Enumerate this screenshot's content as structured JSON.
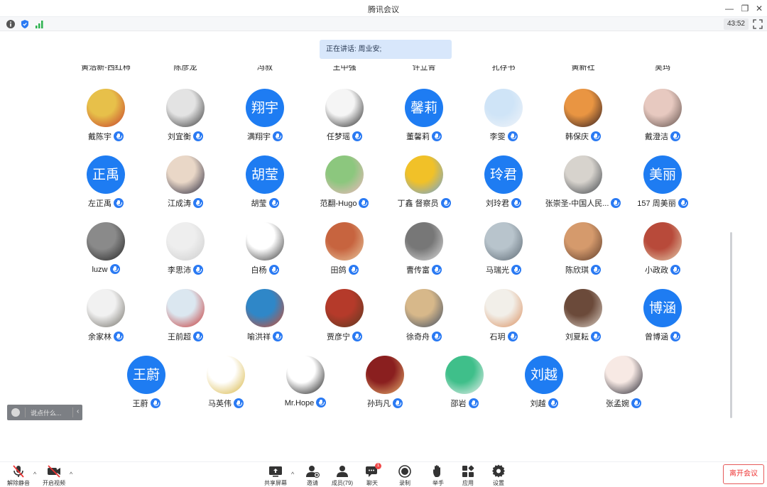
{
  "window": {
    "title": "腾讯会议",
    "min": "—",
    "restore": "❐",
    "close": "✕"
  },
  "infobar": {
    "timer": "43:52"
  },
  "speaking": {
    "text": "正在讲话: 周业安;"
  },
  "cut_row": [
    "黄浩新-西红柿",
    "陈彦龙",
    "冯叔",
    "王中强",
    "许立青",
    "孔存书",
    "黄新社",
    "吴玛"
  ],
  "participants": [
    {
      "name": "戴陈宇",
      "avatar_text": "",
      "avatar_icon": "snoopy-photo",
      "colors": [
        "#e7c04a",
        "#c53a2a"
      ]
    },
    {
      "name": "刘宜衡",
      "avatar_text": "",
      "avatar_icon": "umbrella-photo",
      "colors": [
        "#e3e3e3",
        "#333333"
      ]
    },
    {
      "name": "满翔宇",
      "avatar_text": "翔宇"
    },
    {
      "name": "任梦瑶",
      "avatar_text": "",
      "avatar_icon": "panda-photo",
      "colors": [
        "#f5f5f5",
        "#202020"
      ]
    },
    {
      "name": "董馨莉",
      "avatar_text": "馨莉"
    },
    {
      "name": "李雯",
      "avatar_text": "",
      "avatar_icon": "hand-photo",
      "colors": [
        "#cfe4f7",
        "#f1f4f8"
      ]
    },
    {
      "name": "韩保庆",
      "avatar_text": "",
      "avatar_icon": "sunset-rider-photo",
      "colors": [
        "#e99542",
        "#2b1a20"
      ]
    },
    {
      "name": "戴澄洁",
      "avatar_text": "",
      "avatar_icon": "child-photo",
      "colors": [
        "#e7c9c0",
        "#5a4a45"
      ]
    },
    {
      "name": "左正禹",
      "avatar_text": "正禹"
    },
    {
      "name": "江成涛",
      "avatar_text": "",
      "avatar_icon": "anime-photo",
      "colors": [
        "#e9d7c7",
        "#24243a"
      ]
    },
    {
      "name": "胡莹",
      "avatar_text": "胡莹"
    },
    {
      "name": "范翻-Hugo",
      "avatar_text": "",
      "avatar_icon": "cartoon-photo",
      "colors": [
        "#8cc77e",
        "#f3b8c0"
      ]
    },
    {
      "name": "丁鑫 督察员",
      "avatar_text": "",
      "avatar_icon": "sunflower-photo",
      "colors": [
        "#f1c128",
        "#6aa3e0"
      ]
    },
    {
      "name": "刘玲君",
      "avatar_text": "玲君"
    },
    {
      "name": "张崇圣-中国人民...",
      "avatar_text": "",
      "avatar_icon": "portrait-photo",
      "colors": [
        "#d7d3cd",
        "#3a3f45"
      ]
    },
    {
      "name": "157 周美丽",
      "avatar_text": "美丽"
    },
    {
      "name": "luzw",
      "avatar_text": "",
      "avatar_icon": "bw-photo",
      "colors": [
        "#8a8a8a",
        "#222222"
      ]
    },
    {
      "name": "李思沛",
      "avatar_text": "",
      "avatar_icon": "white-photo",
      "colors": [
        "#eeeeee",
        "#cccccc"
      ]
    },
    {
      "name": "白杨",
      "avatar_text": "",
      "avatar_icon": "sketch-photo",
      "colors": [
        "#ffffff",
        "#333333"
      ]
    },
    {
      "name": "田鸽",
      "avatar_text": "",
      "avatar_icon": "bear-photo",
      "colors": [
        "#c7643f",
        "#e8c9a0"
      ]
    },
    {
      "name": "曹传富",
      "avatar_text": "",
      "avatar_icon": "sponge-photo",
      "colors": [
        "#777777",
        "#dddddd"
      ]
    },
    {
      "name": "马瑞光",
      "avatar_text": "",
      "avatar_icon": "tree-photo",
      "colors": [
        "#b8c4cc",
        "#5a6670"
      ]
    },
    {
      "name": "陈欣琪",
      "avatar_text": "",
      "avatar_icon": "girl-photo",
      "colors": [
        "#d59a6c",
        "#5b3b2a"
      ]
    },
    {
      "name": "小政政",
      "avatar_text": "",
      "avatar_icon": "interior-photo",
      "colors": [
        "#b84a3a",
        "#e4d0b0"
      ]
    },
    {
      "name": "余家林",
      "avatar_text": "",
      "avatar_icon": "cats-photo",
      "colors": [
        "#f1f1f1",
        "#6d6a62"
      ]
    },
    {
      "name": "王前超",
      "avatar_text": "",
      "avatar_icon": "heroes-photo",
      "colors": [
        "#dbe7f0",
        "#c5302e"
      ]
    },
    {
      "name": "喻洪祥",
      "avatar_text": "",
      "avatar_icon": "lighthouse-photo",
      "colors": [
        "#2f87c8",
        "#d44a2a"
      ]
    },
    {
      "name": "贾彦宁",
      "avatar_text": "",
      "avatar_icon": "paddington-photo",
      "colors": [
        "#b53a2a",
        "#5a3b22"
      ]
    },
    {
      "name": "徐奇舟",
      "avatar_text": "",
      "avatar_icon": "forest-photo",
      "colors": [
        "#d7b88a",
        "#3c4b62"
      ]
    },
    {
      "name": "石玥",
      "avatar_text": "",
      "avatar_icon": "cat-photo",
      "colors": [
        "#f2efe9",
        "#d98c5a"
      ]
    },
    {
      "name": "刘夏耘",
      "avatar_text": "",
      "avatar_icon": "player-photo",
      "colors": [
        "#6b4a3a",
        "#ddd2c8"
      ]
    },
    {
      "name": "曾博涵",
      "avatar_text": "博涵"
    },
    {
      "name": "王蔚",
      "avatar_text": "王蔚"
    },
    {
      "name": "马英伟",
      "avatar_text": "",
      "avatar_icon": "crown-photo",
      "colors": [
        "#ffffff",
        "#d6b23a"
      ]
    },
    {
      "name": "Mr.Hope",
      "avatar_text": "",
      "avatar_icon": "frame-photo",
      "colors": [
        "#ffffff",
        "#111111"
      ]
    },
    {
      "name": "孙玙凡",
      "avatar_text": "",
      "avatar_icon": "redroom-photo",
      "colors": [
        "#8a1f1f",
        "#e7b370"
      ]
    },
    {
      "name": "邵岩",
      "avatar_text": "",
      "avatar_icon": "green-toy-photo",
      "colors": [
        "#3fbf8a",
        "#f1f1f1"
      ]
    },
    {
      "name": "刘越",
      "avatar_text": "刘越"
    },
    {
      "name": "张孟婉",
      "avatar_text": "",
      "avatar_icon": "panda-art-photo",
      "colors": [
        "#f7e9e4",
        "#1e1e2a"
      ]
    }
  ],
  "chat": {
    "placeholder": "说点什么..."
  },
  "toolbar": {
    "mute": "解除静音",
    "video": "开启视频",
    "share": "共享屏幕",
    "invite": "邀请",
    "members": "成员(79)",
    "chat": "聊天",
    "chat_badge": "1",
    "record": "录制",
    "raise_hand": "举手",
    "apps": "应用",
    "settings": "设置",
    "leave": "离开会议"
  },
  "colors": {
    "accent": "#1e7cf2",
    "leave": "#e33333",
    "speaking_bg": "#d8e7fb"
  }
}
